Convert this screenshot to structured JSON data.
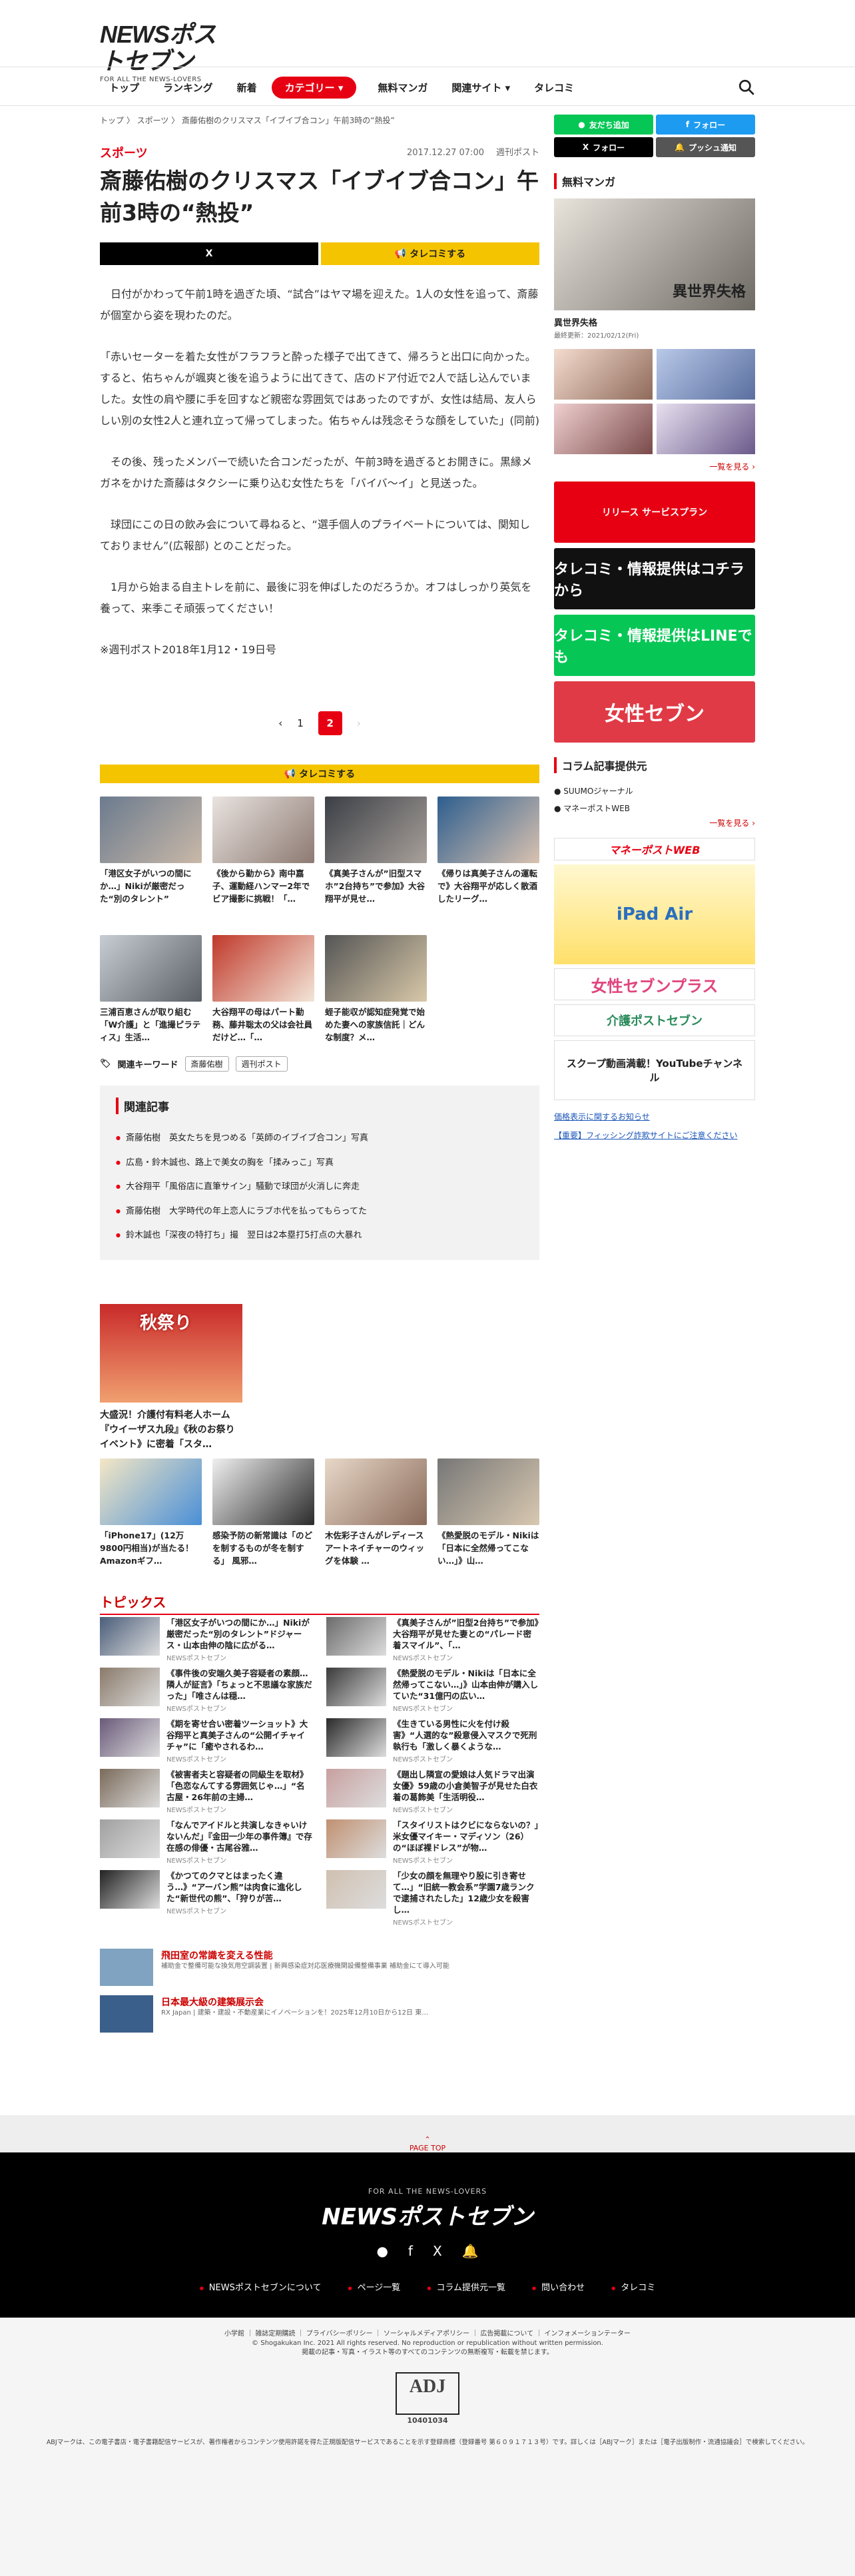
{
  "header": {
    "logo_main": "NEWSポストセブン",
    "logo_sub": "FOR ALL THE NEWS-LOVERS",
    "nav": [
      "トップ",
      "ランキング",
      "新着",
      "カテゴリー",
      "無料マンガ",
      "関連サイト",
      "タレコミ"
    ]
  },
  "breadcrumb": "トップ 〉 スポーツ 〉 斎藤佑樹のクリスマス「イブイブ合コン」午前3時の“熱投”",
  "article": {
    "category": "スポーツ",
    "date": "2017.12.27 07:00",
    "source": "週刊ポスト",
    "title": "斎藤佑樹のクリスマス「イブイブ合コン」午前3時の“熱投”",
    "share_x": "X",
    "share_tarekomi": "タレコミする",
    "paragraphs": [
      "日付がかわって午前1時を過ぎた頃、“試合”はヤマ場を迎えた。1人の女性を追って、斎藤が個室から姿を現わたのだ。",
      "「赤いセーターを着た女性がフラフラと酔った様子で出てきて、帰ろうと出口に向かった。すると、佑ちゃんが颯爽と後を追うように出てきて、店のドア付近で2人で話し込んでいました。女性の肩や腰に手を回すなど親密な雰囲気ではあったのですが、女性は結局、友人らしい別の女性2人と連れ立って帰ってしまった。佑ちゃんは残念そうな顔をしていた」(同前)",
      "その後、残ったメンバーで続いた合コンだったが、午前3時を過ぎるとお開きに。黒縁メガネをかけた斎藤はタクシーに乗り込む女性たちを「バイバ〜イ」と見送った。",
      "球団にこの日の飲み会について尋ねると、“選手個人のプライベートについては、関知しておりません”(広報部) とのことだった。",
      "1月から始まる自主トレを前に、最後に羽を伸ばしたのだろうか。オフはしっかり英気を養って、来季こそ頑張ってください！",
      "※週刊ポスト2018年1月12・19日号"
    ],
    "pager": [
      "‹",
      "1",
      "2",
      "›"
    ],
    "tarekomi2": "タレコミする"
  },
  "cards": [
    "「港区女子がいつの間にか…」Nikiが厳密だった“別のタレント”",
    "《後から勤から》南中嘉子、運動経ハンマー2年でビア撮影に挑戦！「…",
    "《真美子さんが”旧型スマホ”2台持ち”で参加》大谷翔平が見せ…",
    "《帰りは真美子さんの運転で》大谷翔平が応しく散酒したリーグ…",
    "三浦百恵さんが取り組む「W介護」と「進撮ピラティス」生活…",
    "大谷翔平の母はパート勤務、藤井聡太の父は会社員だけど…「…",
    "蛭子能収が認知症発覚で始めた妻への家族信託｜どんな制度？メ…"
  ],
  "keywords": {
    "label": "関連キーワード",
    "tags": [
      "斎藤佑樹",
      "週刊ポスト"
    ]
  },
  "related": {
    "heading": "関連記事",
    "items": [
      "斎藤佑樹　英女たちを見つめる「英師のイブイブ合コン」写真",
      "広島・鈴木誠也、路上で美女の胸を「揉みっこ」写真",
      "大谷翔平「風俗店に直筆サイン」騒動で球団が火消しに奔走",
      "斎藤佑樹　大学時代の年上恋人にラブホ代を払ってもらってた",
      "鈴木誠也「深夜の特打ち」撮　翌日は2本塁打5打点の大暴れ"
    ]
  },
  "promo": {
    "label": "秋祭り",
    "caption": "大盛況！介護付有料老人ホーム『ウイーザス九段』《秋のお祭りイベント》に密着「スタ…"
  },
  "ads4": [
    "「iPhone17」(12万9800円相当)が当たる！Amazonギフ…",
    "感染予防の新常識は「のどを制するものが冬を制する」 風邪…",
    "木佐彩子さんがレディースアートネイチャーのウィッグを体験 …",
    "《熱愛脱のモデル・Nikiは「日本に全然帰ってこない…」》山…"
  ],
  "topics_heading": "トピックス",
  "topics": [
    {
      "t": "「港区女子がいつの間にか…」Nikiが厳密だった“別のタレント”ドジャース・山本由伸の陰に広がる…",
      "s": "NEWSポストセブン"
    },
    {
      "t": "《真美子さんが”旧型2台持ち”で参加》大谷翔平が見せた妻との“パレード密着スマイル”、「…",
      "s": "NEWSポストセブン"
    },
    {
      "t": "《事件後の安端久美子容疑者の素顔…隣人が証言》「ちょっと不思議な家族だった」「唯さんは穏…",
      "s": "NEWSポストセブン"
    },
    {
      "t": "《熱愛脱のモデル・Nikiは「日本に全然帰ってこない…」》山本由伸が購入していた“31億円の広い…",
      "s": "NEWSポストセブン"
    },
    {
      "t": "《期を寄せ合い密着ツーショット》大谷翔平と真美子さんの“公開イチャイチャ”に「癒やされるわ…",
      "s": "NEWSポストセブン"
    },
    {
      "t": "《生きている男性に火を付け殺害》“人選的な”殺意侵入マスクで死刑執行も「激しく暴くような…",
      "s": "NEWSポストセブン"
    },
    {
      "t": "《被害者夫と容疑者の同級生を取材》「色恋なんてする雰囲気じゃ…」“名古屋・26年前の主婦…",
      "s": "NEWSポストセブン"
    },
    {
      "t": "《題出し隣宣の愛娘は人気ドラマ出演女優》59歳の小倉美智子が見せた白衣着の葛飾美「生活明役…",
      "s": "NEWSポストセブン"
    },
    {
      "t": "「なんでアイドルと共演しなきゃいけないんだ」『金田一少年の事件簿』で存在感の俳優・古尾谷雅…",
      "s": "NEWSポストセブン"
    },
    {
      "t": "「スタイリストはクビにならないの？」米女優マイキー・マディソン（26）の“ほぼ裸ドレス”が物…",
      "s": "NEWSポストセブン"
    },
    {
      "t": "《かつてのクマとはまったく違う…》“アーバン熊”は肉食に進化した“新世代の熊”、「狩りが苦…",
      "s": "NEWSポストセブン"
    },
    {
      "t": "「少女の顔を無理やり股に引き寄せて…」“旧統一教会系”学園7歳ランクで逮捕されたした」12歳少女を殺害し…",
      "s": "NEWSポストセブン"
    }
  ],
  "ads": [
    {
      "t1": "飛田室の常識を変える性能",
      "t2": "補助金で整備可能な換気用空調装置 | 新興感染症対応医療機関設備整備事業 補助金にて導入可能"
    },
    {
      "t1": "日本最大級の建築展示会",
      "t2": "RX Japan | 建築・建設・不動産業にイノベーションを！2025年12月10日から12日 東…"
    }
  ],
  "sidebar": {
    "sns": [
      "友だち追加",
      "フォロー",
      "フォロー",
      "プッシュ通知"
    ],
    "manga_heading": "無料マンガ",
    "manga_title": "異世界失格",
    "manga_date": "最終更新：2021/02/12(Fri)",
    "manga_banner": "異世界失格",
    "more1": "一覧を見る ›",
    "banner_service": "リリース サービスプラン",
    "banner_tarekomi": "タレコミ・情報提供はコチラから",
    "banner_line": "タレコミ・情報提供はLINEでも",
    "banner_seven": "女性セブン",
    "column_heading": "コラム記事提供元",
    "column_items": [
      "SUUMOジャーナル",
      "マネーポストWEB"
    ],
    "more2": "一覧を見る ›",
    "moneypost": "マネーポストWEB",
    "ipad": "iPad Air",
    "josei_plus": "女性セブンプラス",
    "kaigo": "介護ポストセブン",
    "youtube": "スクープ動画満載！YouTubeチャンネル",
    "link1": "価格表示に関するお知らせ",
    "link2": "【重要】フィッシング詐欺サイトにご注意ください"
  },
  "footer": {
    "page_top": "PAGE TOP",
    "tagline": "FOR ALL THE NEWS-LOVERS",
    "logo": "NEWSポストセブン",
    "links": [
      "NEWSポストセブンについて",
      "ページ一覧",
      "コラム提供元一覧",
      "問い合わせ",
      "タレコミ"
    ],
    "small_links": "小学館 ｜ 雑誌定期購読 ｜ プライバシーポリシー ｜ ソーシャルメディアポリシー ｜ 広告掲載について ｜ インフォメーションテーター",
    "copyright": "© Shogakukan Inc. 2021 All rights reserved. No reproduction or republication without written permission.",
    "notice": "掲載の記事・写真・イラスト等のすべてのコンテンツの無断複写・転載を禁じます。",
    "adj": "ADJ",
    "adj_num": "10401034",
    "adj_note": "ABJマークは、この電子書店・電子書籍配信サービスが、著作権者からコンテンツ使用許諾を得た正規版配信サービスであることを示す登録商標（登録番号 第６０９１７１３号）です。詳しくは［ABJマーク］または［電子出版制作・流通協議会］で検索してください。"
  },
  "colors": {
    "brand_red": "#e60012",
    "tarekomi_yellow": "#f5c400",
    "line_green": "#06c755",
    "twitter_blue": "#1d9bf0"
  }
}
